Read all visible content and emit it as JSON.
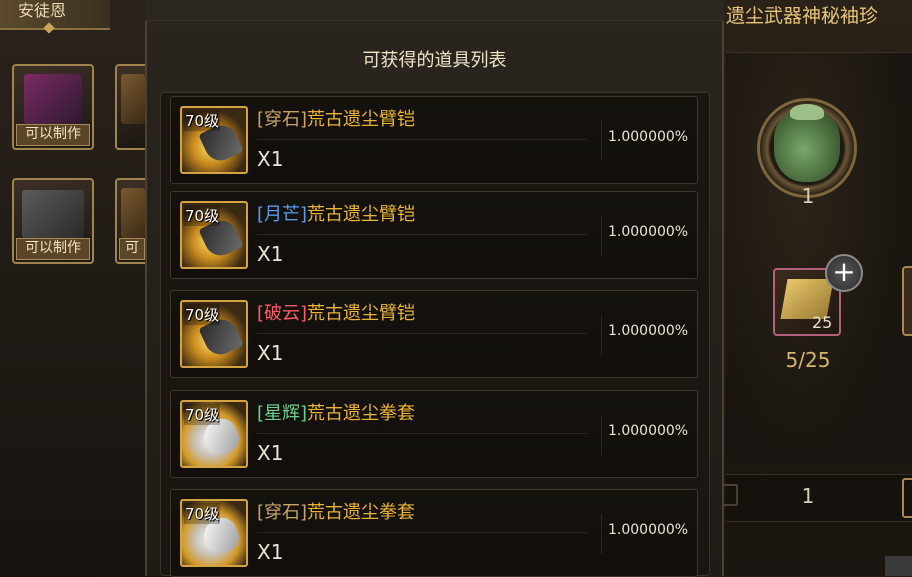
{
  "left_panel": {
    "title": "安徒恩",
    "cards": [
      {
        "label": "可以制作"
      },
      {
        "label": "可以制作"
      },
      {
        "label": "可以制作"
      },
      {
        "label": "可"
      }
    ]
  },
  "right_panel": {
    "title": "遗尘武器神秘袖珍",
    "jar_count": "1",
    "material_qty": "25",
    "material_progress": "5/25",
    "plus_icon": "+",
    "quantity_value": "1"
  },
  "popup": {
    "title": "可获得的道具列表",
    "items": [
      {
        "level": "70级",
        "prefix": "[穿石]",
        "prefix_color": "#c9a46a",
        "name": "荒古遗尘臂铠",
        "qty": "X1",
        "probability": "1.000000%",
        "icon": "arm-guard-icon"
      },
      {
        "level": "70级",
        "prefix": "[月芒]",
        "prefix_color": "#5a9bf0",
        "name": "荒古遗尘臂铠",
        "qty": "X1",
        "probability": "1.000000%",
        "icon": "arm-guard-icon"
      },
      {
        "level": "70级",
        "prefix": "[破云]",
        "prefix_color": "#ff5b6a",
        "name": "荒古遗尘臂铠",
        "qty": "X1",
        "probability": "1.000000%",
        "icon": "arm-guard-icon"
      },
      {
        "level": "70级",
        "prefix": "[星辉]",
        "prefix_color": "#6bd08a",
        "name": "荒古遗尘拳套",
        "qty": "X1",
        "probability": "1.000000%",
        "icon": "gauntlet-icon"
      },
      {
        "level": "70级",
        "prefix": "[穿石]",
        "prefix_color": "#c9a46a",
        "name": "荒古遗尘拳套",
        "qty": "X1",
        "probability": "1.000000%",
        "icon": "gauntlet-icon"
      }
    ]
  }
}
